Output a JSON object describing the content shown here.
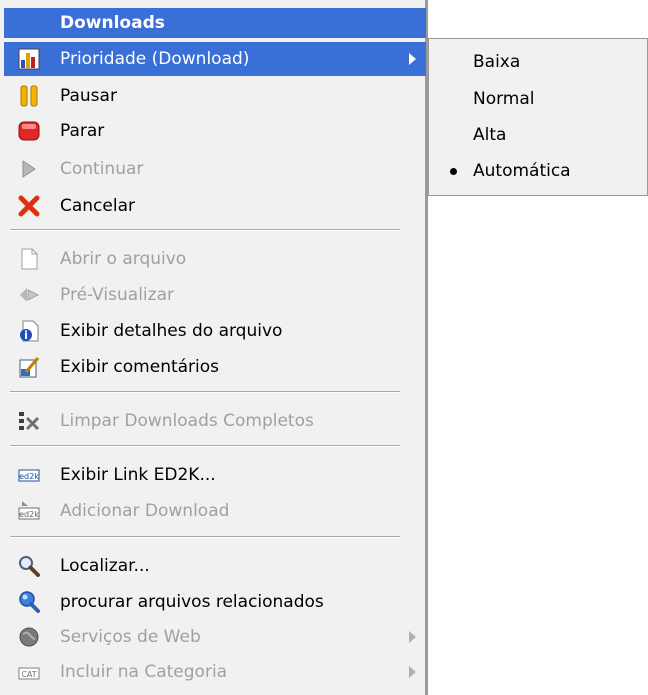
{
  "menu": {
    "title": "Downloads",
    "items": [
      {
        "label": "Prioridade (Download)",
        "icon": "priority-chart-icon",
        "enabled": true,
        "highlighted": true,
        "submenu": true
      },
      {
        "label": "Pausar",
        "icon": "pause-icon",
        "enabled": true
      },
      {
        "label": "Parar",
        "icon": "stop-icon",
        "enabled": true
      },
      {
        "label": "Continuar",
        "icon": "play-icon",
        "enabled": false
      },
      {
        "label": "Cancelar",
        "icon": "cancel-x-icon",
        "enabled": true
      },
      {
        "label": "Abrir o arquivo",
        "icon": "file-icon",
        "enabled": false
      },
      {
        "label": "Pré-Visualizar",
        "icon": "preview-icon",
        "enabled": false
      },
      {
        "label": "Exibir detalhes do arquivo",
        "icon": "file-info-icon",
        "enabled": true
      },
      {
        "label": "Exibir comentários",
        "icon": "comments-icon",
        "enabled": true
      },
      {
        "label": "Limpar Downloads Completos",
        "icon": "clear-completed-icon",
        "enabled": false
      },
      {
        "label": "Exibir Link ED2K...",
        "icon": "ed2k-link-icon",
        "enabled": true
      },
      {
        "label": "Adicionar Download",
        "icon": "ed2k-add-icon",
        "enabled": false
      },
      {
        "label": "Localizar...",
        "icon": "magnifier-icon",
        "enabled": true
      },
      {
        "label": "procurar arquivos relacionados",
        "icon": "search-related-icon",
        "enabled": true
      },
      {
        "label": "Serviços de Web",
        "icon": "globe-icon",
        "enabled": false,
        "submenu": true
      },
      {
        "label": "Incluir na Categoria",
        "icon": "category-icon",
        "enabled": false,
        "submenu": true
      }
    ]
  },
  "submenu": {
    "items": [
      {
        "label": "Baixa",
        "selected": false
      },
      {
        "label": "Normal",
        "selected": false
      },
      {
        "label": "Alta",
        "selected": false
      },
      {
        "label": "Automática",
        "selected": true
      }
    ]
  },
  "colors": {
    "highlight": "#3a6fd8",
    "menu_bg": "#f1f1f1",
    "disabled_text": "#a0a0a0"
  }
}
